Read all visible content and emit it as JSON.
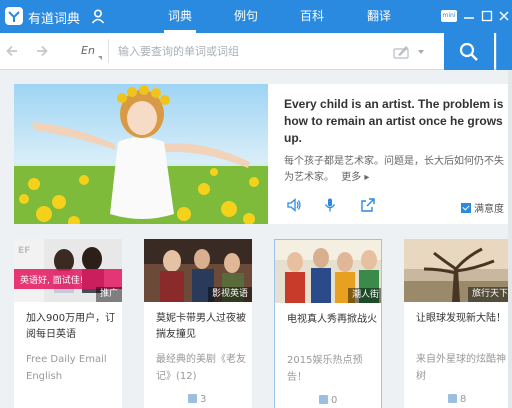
{
  "app": {
    "title": "有道词典"
  },
  "tabs": [
    {
      "label": "词典",
      "active": true
    },
    {
      "label": "例句",
      "active": false
    },
    {
      "label": "百科",
      "active": false
    },
    {
      "label": "翻译",
      "active": false
    }
  ],
  "window_controls": {
    "mini_label": "mini"
  },
  "search": {
    "language": "En",
    "placeholder": "输入要查询的单词或词组",
    "value": ""
  },
  "featured": {
    "quote_en": "Every child is an artist. The problem is how to remain an artist once he grows up.",
    "quote_cn": "每个孩子都是艺术家。问题是，长大后如何仍不失为艺术家。",
    "more_label": "更多",
    "satisfaction_label": "满意度",
    "satisfaction_checked": true,
    "icons": [
      "speaker-icon",
      "microphone-icon",
      "share-icon"
    ]
  },
  "cards": [
    {
      "tag": "推广",
      "title": "加入900万用户，订阅每日英语",
      "desc": "Free Daily Email English",
      "likes": "",
      "banner_text": "英语好, 面试佳!"
    },
    {
      "tag": "影视英语",
      "title": "莫妮卡带男人过夜被揣友撞见",
      "desc": "最经典的美剧《老友记》(12)",
      "likes": "3"
    },
    {
      "tag": "潮人街",
      "title": "电视真人秀再掀战火",
      "desc": "2015娱乐热点预告！",
      "likes": "0"
    },
    {
      "tag": "旅行天下",
      "title": "让眼球发现新大陆！",
      "desc": "来自外星球的炫酷神树",
      "likes": "8"
    }
  ],
  "colors": {
    "brand": "#2a8ae0",
    "background": "#eef1f4"
  }
}
